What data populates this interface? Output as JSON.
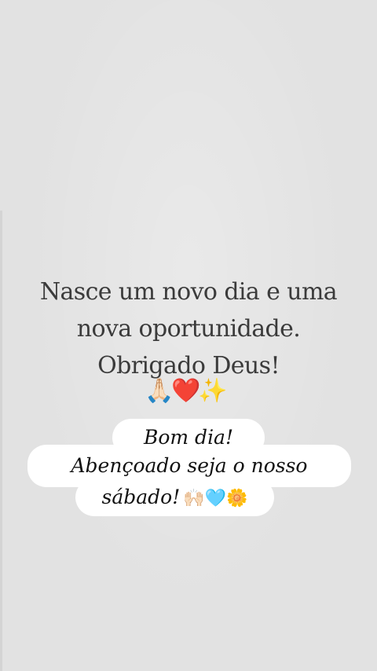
{
  "quote": {
    "line1": "Nasce um novo dia e uma",
    "line2": "nova oportunidade.",
    "line3": "Obrigado Deus!",
    "emoji_pray": "🙏🏻",
    "emoji_heart": "❤️",
    "emoji_sparkles": "✨"
  },
  "caption": {
    "line1": "Bom dia!",
    "line2": "Abençoado seja o nosso",
    "line3": "sábado!",
    "emoji_raise": "🙌🏻",
    "emoji_blue_heart": "🩵",
    "emoji_flower": "🌼"
  }
}
